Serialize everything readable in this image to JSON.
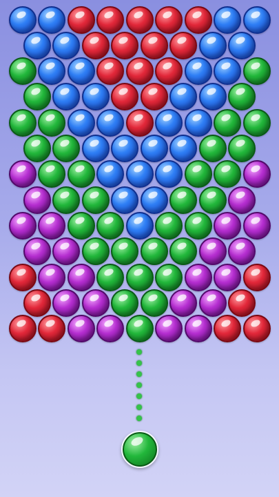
{
  "colors": {
    "blue": "#2f7ff5",
    "red": "#e2283a",
    "green": "#22b73b",
    "purple": "#b52ed0",
    "background_top": "#8a8fe0",
    "background_bottom": "#d2d3f6",
    "aim_dot": "#36c24a"
  },
  "grid": {
    "rows": [
      [
        "blue",
        "blue",
        "red",
        "red",
        "red",
        "red",
        "red",
        "blue",
        "blue"
      ],
      [
        "blue",
        "blue",
        "red",
        "red",
        "red",
        "red",
        "blue",
        "blue"
      ],
      [
        "green",
        "blue",
        "blue",
        "red",
        "red",
        "red",
        "blue",
        "blue",
        "green"
      ],
      [
        "green",
        "blue",
        "blue",
        "red",
        "red",
        "blue",
        "blue",
        "green"
      ],
      [
        "green",
        "green",
        "blue",
        "blue",
        "red",
        "blue",
        "blue",
        "green",
        "green"
      ],
      [
        "green",
        "green",
        "blue",
        "blue",
        "blue",
        "blue",
        "green",
        "green"
      ],
      [
        "purple",
        "green",
        "green",
        "blue",
        "blue",
        "blue",
        "green",
        "green",
        "purple"
      ],
      [
        "purple",
        "green",
        "green",
        "blue",
        "blue",
        "green",
        "green",
        "purple"
      ],
      [
        "purple",
        "purple",
        "green",
        "green",
        "blue",
        "green",
        "green",
        "purple",
        "purple"
      ],
      [
        "purple",
        "purple",
        "green",
        "green",
        "green",
        "green",
        "purple",
        "purple"
      ],
      [
        "red",
        "purple",
        "purple",
        "green",
        "green",
        "green",
        "purple",
        "purple",
        "red"
      ],
      [
        "red",
        "purple",
        "purple",
        "green",
        "green",
        "purple",
        "purple",
        "red"
      ],
      [
        "red",
        "red",
        "purple",
        "purple",
        "green",
        "purple",
        "purple",
        "red",
        "red"
      ]
    ]
  },
  "aim_line": {
    "dot_count": 7
  },
  "shooter": {
    "color": "green"
  }
}
